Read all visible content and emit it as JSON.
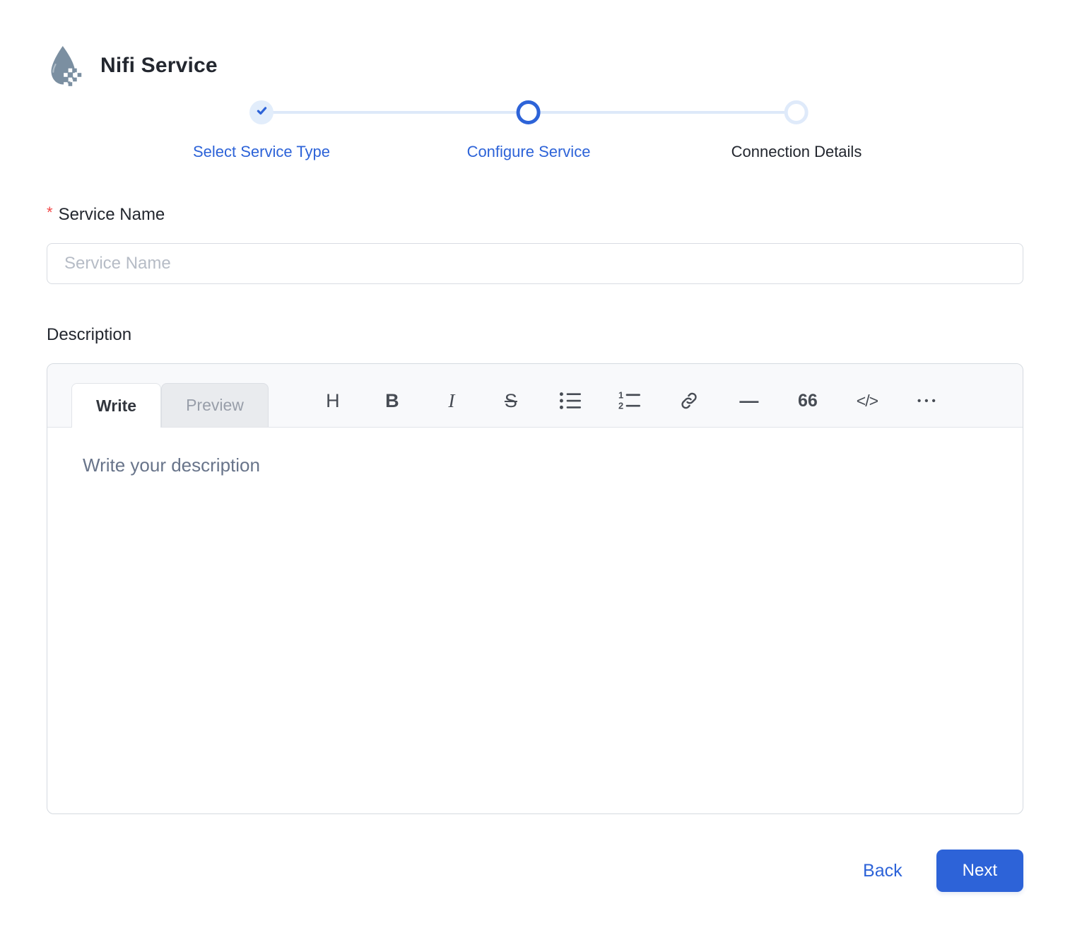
{
  "header": {
    "title": "Nifi Service",
    "icon": "nifi-droplet"
  },
  "stepper": {
    "steps": [
      {
        "label": "Select Service Type",
        "state": "completed"
      },
      {
        "label": "Configure Service",
        "state": "active"
      },
      {
        "label": "Connection Details",
        "state": "pending"
      }
    ]
  },
  "form": {
    "service_name": {
      "label": "Service Name",
      "required_marker": "*",
      "placeholder": "Service Name",
      "value": ""
    },
    "description": {
      "label": "Description"
    }
  },
  "editor": {
    "tabs": [
      {
        "label": "Write",
        "active": true
      },
      {
        "label": "Preview",
        "active": false
      }
    ],
    "toolbar": [
      {
        "name": "heading",
        "glyph": "H"
      },
      {
        "name": "bold",
        "glyph": "B"
      },
      {
        "name": "italic",
        "glyph": "I"
      },
      {
        "name": "strikethrough",
        "glyph": "S"
      },
      {
        "name": "bulleted-list"
      },
      {
        "name": "numbered-list"
      },
      {
        "name": "link"
      },
      {
        "name": "horizontal-rule",
        "glyph": "—"
      },
      {
        "name": "quote",
        "glyph": "66"
      },
      {
        "name": "code",
        "glyph": "</>"
      },
      {
        "name": "more-options",
        "glyph": "•••"
      }
    ],
    "placeholder": "Write your description",
    "value": ""
  },
  "footer": {
    "back_label": "Back",
    "next_label": "Next"
  },
  "colors": {
    "accent": "#2d63d8",
    "accent_light": "#e2edfb",
    "stepper_line": "#dde9f9",
    "text": "#23272f",
    "placeholder_gray": "#b6bcc6",
    "placeholder_slate": "#68748a",
    "border": "#d8dce2",
    "toolbar_bg": "#f8f9fb",
    "required": "#f24848",
    "logo_slate": "#7b8fa1"
  }
}
